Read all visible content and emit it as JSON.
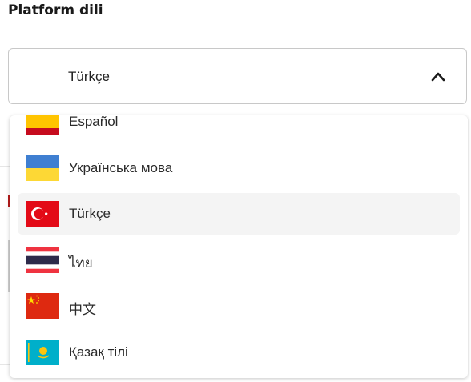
{
  "settings": {
    "section_title": "Platform dili",
    "select": {
      "value": "Türkçe",
      "expanded": true
    }
  },
  "dropdown": {
    "options": [
      {
        "label": "Español",
        "flag": "spain-flag-icon"
      },
      {
        "label": "Українська мова",
        "flag": "ukraine-flag-icon"
      },
      {
        "label": "Türkçe",
        "flag": "turkey-flag-icon",
        "selected": true
      },
      {
        "label": "ไทย",
        "flag": "thailand-flag-icon"
      },
      {
        "label": "中文",
        "flag": "china-flag-icon"
      },
      {
        "label": "Қазақ тілі",
        "flag": "kazakhstan-flag-icon"
      }
    ]
  },
  "colors": {
    "selected_bg": "#f4f4f4",
    "border": "#c8c8c8",
    "text": "#212121"
  }
}
